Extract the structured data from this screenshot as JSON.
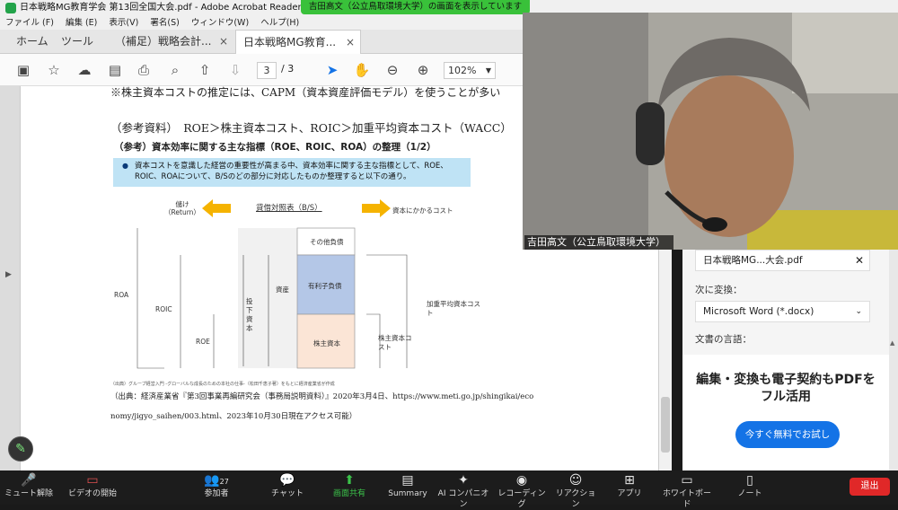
{
  "window": {
    "title": "日本戦略MG教育学会 第13回全国大会.pdf - Adobe Acrobat Reader (64-bit)",
    "share_banner": "吉田高文（公立鳥取環境大学）の画面を表示しています"
  },
  "menu": [
    "ファイル (F)",
    "編集 (E)",
    "表示(V)",
    "署名(S)",
    "ウィンドウ(W)",
    "ヘルプ(H)"
  ],
  "tabs": {
    "home": "ホーム",
    "tools": "ツール",
    "tab1": "（補足）戦略会計...",
    "tab2": "日本戦略MG教育...",
    "close": "×"
  },
  "toolbar": {
    "page_current": "3",
    "page_total": "/ 3",
    "zoom": "102%"
  },
  "doc": {
    "line_top": "※株主資本コストの推定には、CAPM（資本資産評価モデル）を使うことが多い",
    "ref_heading": "（参考資料）　ROE＞株主資本コスト、ROIC＞加重平均資本コスト（WACC）",
    "slide_title": "（参考）資本効率に関する主な指標（ROE、ROIC、ROA）の整理（1/2）",
    "bullet": "資本コストを意識した経営の重要性が高まる中、資本効率に関する主な指標として、ROE、ROIC、ROAについて、B/Sのどの部分に対応したものか整理すると以下の通り。",
    "diagram": {
      "left_arrow_label": "儲け（Return）",
      "center_title": "貸借対照表（B/S）",
      "right_arrow_label": "資本にかかるコスト",
      "roa": "ROA",
      "roic": "ROIC",
      "roe": "ROE",
      "invested": "投下資本",
      "assets": "資産",
      "other_liab": "その他負債",
      "interest_liab": "有利子負債",
      "equity": "株主資本",
      "wacc": "加重平均資本コスト",
      "equity_cost": "株主資本コスト",
      "source": "（出典）グループ経営入門 -グローバルな成長のための本社の仕事-（松田千恵子著）をもとに経済産業省が作成"
    },
    "citation_1": "（出典：経済産業省『第3回事業再編研究会（事務局説明資料）』2020年3月4日、https://www.meti.go.jp/shingikai/eco",
    "citation_2": "nomy/jigyo_saihen/003.html、2023年10月30日現在アクセス可能）"
  },
  "video": {
    "name": "吉田高文（公立鳥取環境大学）"
  },
  "right_panel": {
    "file": "日本戦略MG...大会.pdf",
    "convert_label": "次に変換：",
    "convert_value": "Microsoft Word (*.docx)",
    "lang_label": "文書の言語：",
    "ad_text": "編集・変換も電子契約もPDFをフル活用",
    "ad_button": "今すぐ無料でお試し"
  },
  "zoom": {
    "mute": "ミュート解除",
    "video": "ビデオの開始",
    "participants": "参加者",
    "participants_count": "27",
    "chat": "チャット",
    "share": "画面共有",
    "summary": "Summary",
    "ai": "AI コンパニオン",
    "record": "レコーディング",
    "reactions": "リアクション",
    "apps": "アプリ",
    "whiteboard": "ホワイトボード",
    "notes": "ノート",
    "leave": "退出"
  }
}
